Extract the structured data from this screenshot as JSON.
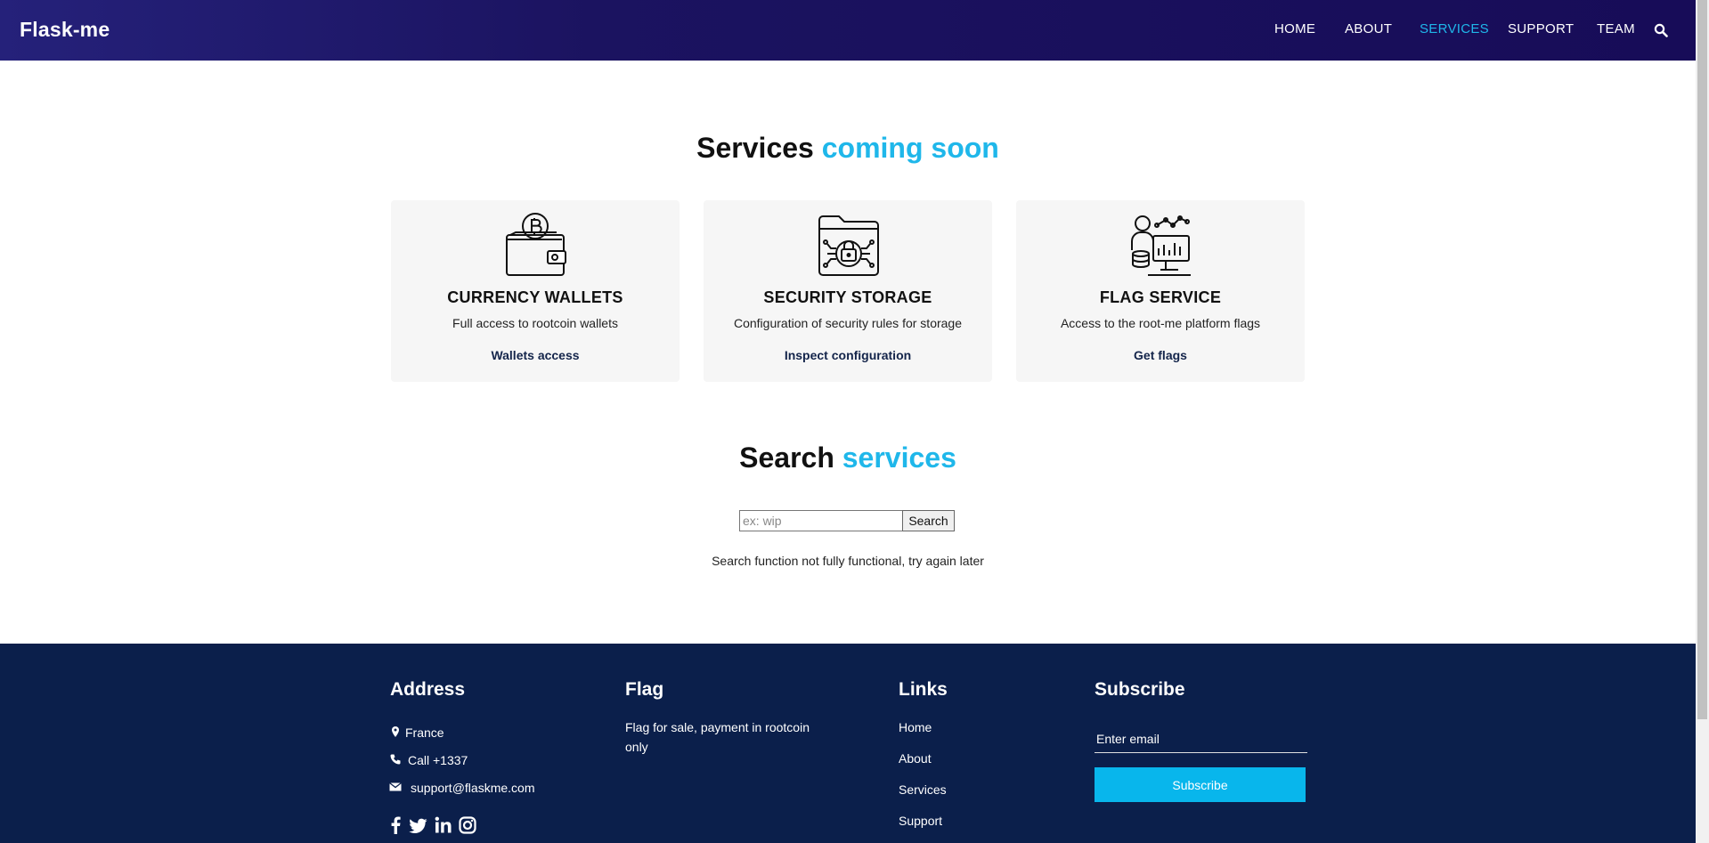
{
  "header": {
    "brand": "Flask-me",
    "nav": [
      "HOME",
      "ABOUT",
      "SERVICES",
      "SUPPORT",
      "TEAM"
    ],
    "active_nav": "SERVICES",
    "search_icon": "search-icon"
  },
  "services": {
    "title_main": "Services",
    "title_accent": "coming soon",
    "cards": [
      {
        "icon": "bitcoin-wallet-icon",
        "title": "CURRENCY WALLETS",
        "desc": "Full access to rootcoin wallets",
        "link": "Wallets access"
      },
      {
        "icon": "secure-folder-icon",
        "title": "SECURITY STORAGE",
        "desc": "Configuration of security rules for storage",
        "link": "Inspect configuration"
      },
      {
        "icon": "flag-analytics-icon",
        "title": "FLAG SERVICE",
        "desc": "Access to the root-me platform flags",
        "link": "Get flags"
      }
    ]
  },
  "search": {
    "title_main": "Search",
    "title_accent": "services",
    "placeholder": "ex: wip",
    "button": "Search",
    "message": "Search function not fully functional, try again later"
  },
  "footer": {
    "address": {
      "heading": "Address",
      "location": "France",
      "phone": "Call +1337",
      "email": "support@flaskme.com"
    },
    "flag": {
      "heading": "Flag",
      "line1": "Flag for sale, payment in rootcoin",
      "line2": "only"
    },
    "links": {
      "heading": "Links",
      "items": [
        "Home",
        "About",
        "Services",
        "Support"
      ]
    },
    "subscribe": {
      "heading": "Subscribe",
      "placeholder": "Enter email",
      "button": "Subscribe"
    },
    "social_icons": [
      "facebook-icon",
      "twitter-icon",
      "linkedin-icon",
      "instagram-icon"
    ]
  },
  "colors": {
    "accent": "#1fb7ea",
    "header_bg": "#1b1360",
    "footer_bg": "#0b1f4b",
    "subscribe_bg": "#08b6ec"
  }
}
